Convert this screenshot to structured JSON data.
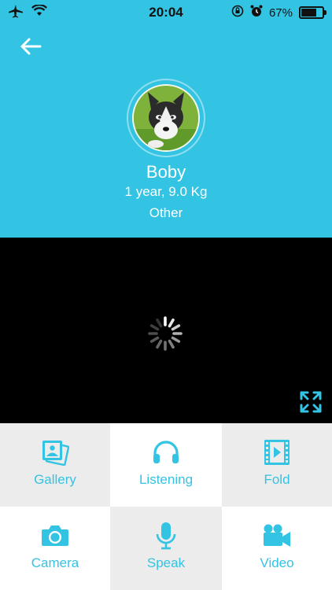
{
  "status_bar": {
    "time": "20:04",
    "battery": "67%"
  },
  "pet": {
    "name": "Boby",
    "details": "1 year, 9.0 Kg",
    "breed": "Other"
  },
  "actions": [
    {
      "label": "Gallery",
      "icon": "gallery-icon"
    },
    {
      "label": "Listening",
      "icon": "headphones-icon"
    },
    {
      "label": "Fold",
      "icon": "film-icon"
    },
    {
      "label": "Camera",
      "icon": "camera-icon"
    },
    {
      "label": "Speak",
      "icon": "microphone-icon"
    },
    {
      "label": "Video",
      "icon": "video-camera-icon"
    }
  ],
  "colors": {
    "accent": "#33c3e3",
    "video_bg": "#000000",
    "cell_gray": "#ececec"
  }
}
